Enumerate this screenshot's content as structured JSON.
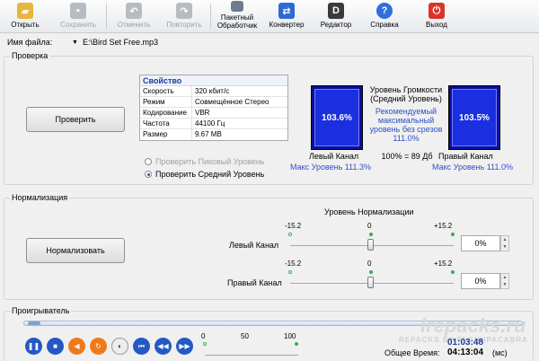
{
  "toolbar": {
    "open": "Открыть",
    "save": "Сохранить",
    "undo": "Отменить",
    "redo": "Повторить",
    "batch_line1": "Пакетный",
    "batch_line2": "Обработчик",
    "converter": "Конвертер",
    "editor": "Редактор",
    "help": "Справка",
    "exit": "Выход"
  },
  "file": {
    "label": "Имя файла:",
    "value": "E:\\Bird Set Free.mp3"
  },
  "check": {
    "title": "Проверка",
    "button": "Проверить",
    "table_header": "Свойство",
    "props": [
      {
        "k": "Скорость",
        "v": "320 кбит/с"
      },
      {
        "k": "Режим",
        "v": "Совмещённое Стерео"
      },
      {
        "k": "Кодирование",
        "v": "VBR"
      },
      {
        "k": "Частота",
        "v": "44100 Гц"
      },
      {
        "k": "Размер",
        "v": "9.67 MB"
      }
    ],
    "radio_peak": "Проверить Пиковый Уровень",
    "radio_avg": "Проверить Средний Уровень",
    "left_meter": "103.6%",
    "right_meter": "103.5%",
    "left_meter_value": 1.0,
    "right_meter_value": 1.0,
    "loudness_line1": "Уровень Громкости",
    "loudness_line2": "(Средний Уровень)",
    "rec_line1": "Рекомендуемый",
    "rec_line2": "максимальный",
    "rec_line3": "уровень без срезов",
    "rec_line4": "111.0%",
    "left_label": "Левый Канал",
    "right_label": "Правый Канал",
    "db": "100% = 89 Дб",
    "left_max": "Макс Уровень 111.3%",
    "right_max": "Макс Уровень 111.0%"
  },
  "norm": {
    "title": "Нормализация",
    "button": "Нормализовать",
    "level_title": "Уровень Нормализации",
    "min": "-15.2",
    "mid": "0",
    "max": "+15.2",
    "left_label": "Левый Канал",
    "right_label": "Правый Канал",
    "left_value": "0%",
    "right_value": "0%"
  },
  "player": {
    "title": "Проигрыватель",
    "vol_min": "0",
    "vol_mid": "50",
    "vol_max": "100",
    "time_current": "01:03:48",
    "total_label": "Общее Время:",
    "time_total": "04:13:04",
    "time_unit": "(мс)"
  },
  "watermark": {
    "main": "lrepacks.ru",
    "sub": "REPACKS BY ELCHUPACABRA"
  },
  "colors": {
    "meter_bg": "#0b0f9a",
    "accent_blue": "#2d4fc9",
    "play_blue": "#2458c4",
    "orange": "#f07a1a",
    "green_dot": "#2fb14b"
  }
}
